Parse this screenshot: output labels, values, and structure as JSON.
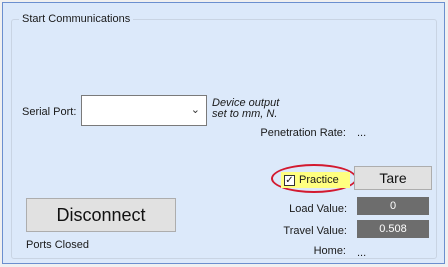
{
  "group": {
    "title": "Start Communications"
  },
  "serial_port": {
    "label": "Serial Port:",
    "value": "",
    "chevron": "chevron-down-icon"
  },
  "device_note": {
    "line1": "Device output",
    "line2": "set to mm, N."
  },
  "penetration": {
    "label": "Penetration Rate:",
    "value": "..."
  },
  "practice": {
    "label": "Practice",
    "checked": true
  },
  "tare_button": "Tare",
  "disconnect_button": "Disconnect",
  "load": {
    "label": "Load Value:",
    "value": "0"
  },
  "travel": {
    "label": "Travel Value:",
    "value": "0.508"
  },
  "home": {
    "label": "Home:",
    "value": "..."
  },
  "status": "Ports Closed",
  "colors": {
    "highlight": "#ffff80",
    "annotation": "#d3192f",
    "value_box": "#6d6d6d"
  }
}
